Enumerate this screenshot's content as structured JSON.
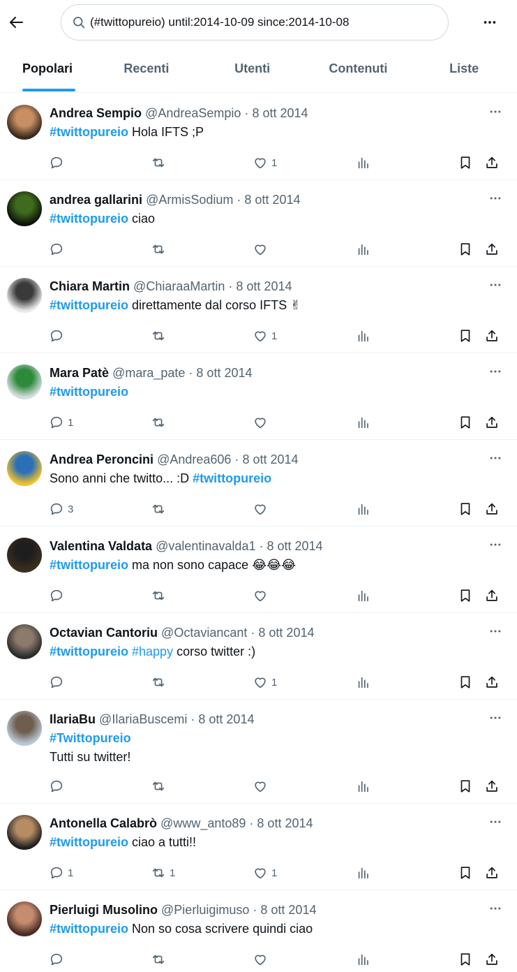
{
  "search": {
    "value": "(#twittopureio) until:2014-10-09 since:2014-10-08"
  },
  "tabs": [
    {
      "label": "Popolari"
    },
    {
      "label": "Recenti"
    },
    {
      "label": "Utenti"
    },
    {
      "label": "Contenuti"
    },
    {
      "label": "Liste"
    }
  ],
  "active_tab": "Popolari",
  "colors": {
    "accent": "#1d9bf0",
    "text": "#0f1419",
    "muted": "#536471",
    "border": "#eff3f4"
  },
  "icons": [
    "back-arrow-icon",
    "search-icon",
    "more-icon",
    "reply-icon",
    "retweet-icon",
    "like-icon",
    "views-icon",
    "bookmark-icon",
    "share-icon"
  ],
  "tweets": [
    {
      "name": "Andrea Sempio",
      "handle": "@AndreaSempio",
      "sep": "·",
      "date": "8 ott 2014",
      "text": [
        {
          "t": "#twittopureio",
          "tag": true
        },
        {
          "t": " Hola IFTS ;P"
        }
      ],
      "replies": "",
      "retweets": "",
      "likes": "1"
    },
    {
      "name": "andrea gallarini",
      "handle": "@ArmisSodium",
      "sep": "·",
      "date": "8 ott 2014",
      "text": [
        {
          "t": "#twittopureio",
          "tag": true
        },
        {
          "t": " ciao"
        }
      ],
      "replies": "",
      "retweets": "",
      "likes": ""
    },
    {
      "name": "Chiara Martin",
      "handle": "@ChiaraaMartin",
      "sep": "·",
      "date": "8 ott 2014",
      "text": [
        {
          "t": "#twittopureio",
          "tag": true
        },
        {
          "t": " direttamente dal corso IFTS ✌"
        }
      ],
      "replies": "",
      "retweets": "",
      "likes": "1"
    },
    {
      "name": "Mara Patè",
      "handle": "@mara_pate",
      "sep": "·",
      "date": "8 ott 2014",
      "text": [
        {
          "t": "#twittopureio",
          "tag": true
        }
      ],
      "replies": "1",
      "retweets": "",
      "likes": ""
    },
    {
      "name": "Andrea Peroncini",
      "handle": "@Andrea606",
      "sep": "·",
      "date": "8 ott 2014",
      "text": [
        {
          "t": "Sono anni che twitto... :D "
        },
        {
          "t": "#twittopureio",
          "tag": true
        }
      ],
      "replies": "3",
      "retweets": "",
      "likes": ""
    },
    {
      "name": "Valentina Valdata",
      "handle": "@valentinavalda1",
      "sep": "·",
      "date": "8 ott 2014",
      "text": [
        {
          "t": "#twittopureio",
          "tag": true
        },
        {
          "t": " ma non sono capace 😂😂😂"
        }
      ],
      "replies": "",
      "retweets": "",
      "likes": ""
    },
    {
      "name": "Octavian Cantoriu",
      "handle": "@Octaviancant",
      "sep": "·",
      "date": "8 ott 2014",
      "text": [
        {
          "t": "#twittopureio",
          "tag": true
        },
        {
          "t": " "
        },
        {
          "t": "#happy",
          "tag": true,
          "light": true
        },
        {
          "t": " corso twitter :)"
        }
      ],
      "replies": "",
      "retweets": "",
      "likes": "1"
    },
    {
      "name": "IlariaBu",
      "handle": "@IlariaBuscemi",
      "sep": "·",
      "date": "8 ott 2014",
      "text": [
        {
          "t": "#Twittopureio",
          "tag": true
        },
        {
          "br": true
        },
        {
          "t": "Tutti su twitter!"
        }
      ],
      "replies": "",
      "retweets": "",
      "likes": "",
      "tall": true
    },
    {
      "name": "Antonella Calabrò",
      "handle": "@www_anto89",
      "sep": "·",
      "date": "8 ott 2014",
      "text": [
        {
          "t": "#twittopureio",
          "tag": true
        },
        {
          "t": " ciao a tutti!!"
        }
      ],
      "replies": "1",
      "retweets": "1",
      "likes": "1"
    },
    {
      "name": "Pierluigi Musolino",
      "handle": "@Pierluigimuso",
      "sep": "·",
      "date": "8 ott 2014",
      "text": [
        {
          "t": "#twittopureio",
          "tag": true
        },
        {
          "t": " Non so cosa scrivere quindi ciao"
        }
      ],
      "replies": "",
      "retweets": "",
      "likes": ""
    }
  ]
}
